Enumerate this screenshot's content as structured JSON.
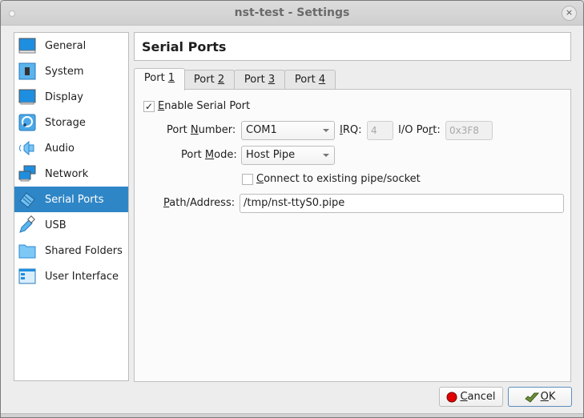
{
  "window": {
    "title": "nst-test - Settings",
    "close_glyph": "×"
  },
  "sidebar": {
    "items": [
      {
        "label": "General",
        "icon": "monitor-icon",
        "selected": false
      },
      {
        "label": "System",
        "icon": "chip-icon",
        "selected": false
      },
      {
        "label": "Display",
        "icon": "display-icon",
        "selected": false
      },
      {
        "label": "Storage",
        "icon": "disk-icon",
        "selected": false
      },
      {
        "label": "Audio",
        "icon": "speaker-icon",
        "selected": false
      },
      {
        "label": "Network",
        "icon": "network-icon",
        "selected": false
      },
      {
        "label": "Serial Ports",
        "icon": "serial-port-icon",
        "selected": true
      },
      {
        "label": "USB",
        "icon": "usb-icon",
        "selected": false
      },
      {
        "label": "Shared Folders",
        "icon": "folder-icon",
        "selected": false
      },
      {
        "label": "User Interface",
        "icon": "window-icon",
        "selected": false
      }
    ]
  },
  "main": {
    "section_title": "Serial Ports",
    "tabs": [
      {
        "prefix": "Port ",
        "mnemonic": "1",
        "active": true
      },
      {
        "prefix": "Port ",
        "mnemonic": "2",
        "active": false
      },
      {
        "prefix": "Port ",
        "mnemonic": "3",
        "active": false
      },
      {
        "prefix": "Port ",
        "mnemonic": "4",
        "active": false
      }
    ],
    "enable": {
      "mnemonic": "E",
      "rest": "nable Serial Port",
      "checked": true,
      "check_glyph": "✓"
    },
    "port_number": {
      "label_pre": "Port ",
      "mnemonic": "N",
      "label_post": "umber:",
      "value": "COM1"
    },
    "irq": {
      "mnemonic": "I",
      "label_post": "RQ:",
      "value": "4"
    },
    "io_port": {
      "label_pre": "I/O Po",
      "mnemonic": "r",
      "label_post": "t:",
      "value": "0x3F8"
    },
    "port_mode": {
      "label_pre": "Port ",
      "mnemonic": "M",
      "label_post": "ode:",
      "value": "Host Pipe"
    },
    "connect_existing": {
      "mnemonic": "C",
      "rest": "onnect to existing pipe/socket",
      "checked": false
    },
    "path": {
      "mnemonic": "P",
      "label_post": "ath/Address:",
      "value": "/tmp/nst-ttyS0.pipe"
    }
  },
  "buttons": {
    "cancel": {
      "mnemonic": "C",
      "rest": "ancel"
    },
    "ok": {
      "mnemonic": "O",
      "rest": "K"
    }
  },
  "colors": {
    "selection": "#2f86c6",
    "icon_blue": "#1e90e0"
  }
}
